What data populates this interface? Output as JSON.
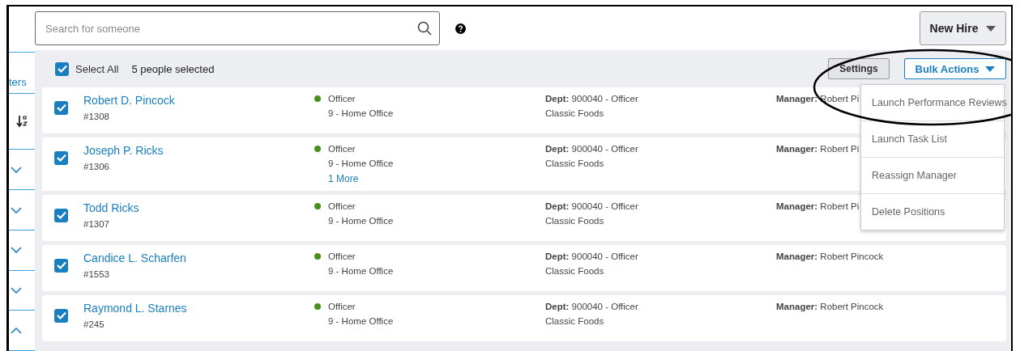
{
  "search": {
    "placeholder": "Search for someone"
  },
  "new_hire_button": {
    "label": "New Hire"
  },
  "sidebar": {
    "filters_label": "ters",
    "sections": [
      {
        "expanded": false
      },
      {
        "expanded": false
      },
      {
        "expanded": false
      },
      {
        "expanded": false
      },
      {
        "expanded": true
      }
    ]
  },
  "toolbar": {
    "select_all": {
      "label": "Select All",
      "checked": true
    },
    "selection_count": "5 people selected",
    "settings_button": "Settings",
    "bulk_actions_button": "Bulk Actions"
  },
  "bulk_actions_menu": {
    "items": [
      "Launch Performance Reviews",
      "Launch Task List",
      "Reassign Manager",
      "Delete Positions"
    ]
  },
  "people": [
    {
      "name": "Robert D. Pincock",
      "number": "#1308",
      "checked": true,
      "color": "#4a8f1e",
      "title": "Officer",
      "location": "9 - Home Office",
      "dept": "**Dept:** 900040 - Officer",
      "company": "Classic Foods",
      "manager": "**Manager:** Robert Pi"
    },
    {
      "name": "Joseph P. Ricks",
      "number": "#1306",
      "checked": true,
      "color": "#4a8f1e",
      "title": "Officer",
      "location": "9 - Home Office",
      "more": "1 More",
      "dept": "**Dept:** 900040 - Officer",
      "company": "Classic Foods",
      "manager": "**Manager:** Robert Pi"
    },
    {
      "name": "Todd Ricks",
      "number": "#1307",
      "checked": true,
      "color": "#4a8f1e",
      "title": "Officer",
      "location": "9 - Home Office",
      "dept": "**Dept:** 900040 - Officer",
      "company": "Classic Foods",
      "manager": "**Manager:** Robert Pi"
    },
    {
      "name": "Candice L. Scharfen",
      "number": "#1553",
      "checked": true,
      "color": "#4a8f1e",
      "title": "Officer",
      "location": "9 - Home Office",
      "dept": "**Dept:** 900040 - Officer",
      "company": "Classic Foods",
      "manager": "**Manager:** Robert Pincock"
    },
    {
      "name": "Raymond L. Starnes",
      "number": "#245",
      "checked": true,
      "color": "#4a8f1e",
      "title": "Officer",
      "location": "9 - Home Office",
      "dept": "**Dept:** 900040 - Officer",
      "company": "Classic Foods",
      "manager": "**Manager:** Robert Pincock"
    }
  ]
}
